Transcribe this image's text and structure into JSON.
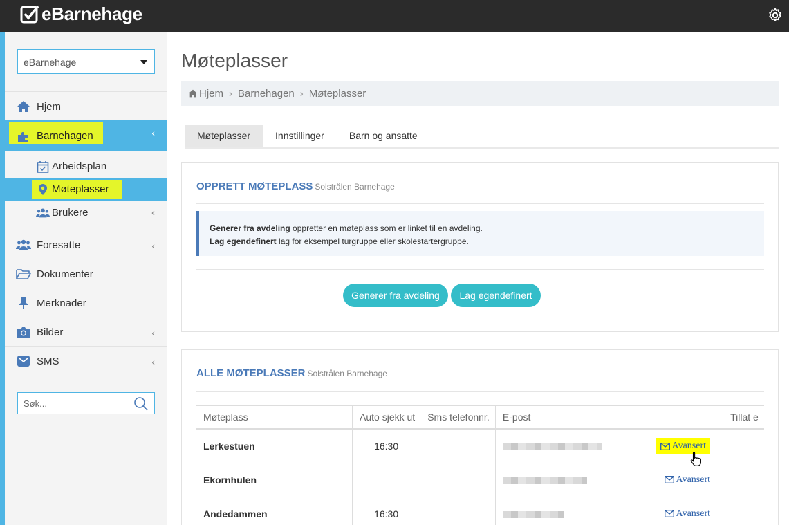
{
  "app": {
    "brand": "eBarnehage"
  },
  "sidebar": {
    "kindergarten_select": "eBarnehage",
    "items": [
      {
        "label": "Hjem",
        "icon": "home-icon"
      },
      {
        "label": "Barnehagen",
        "icon": "puzzle-icon"
      },
      {
        "label": "Foresatte",
        "icon": "users-icon"
      },
      {
        "label": "Dokumenter",
        "icon": "folder-icon"
      },
      {
        "label": "Merknader",
        "icon": "pin-icon"
      },
      {
        "label": "Bilder",
        "icon": "camera-icon"
      },
      {
        "label": "SMS",
        "icon": "envelope-icon"
      }
    ],
    "subitems": [
      {
        "label": "Arbeidsplan",
        "icon": "calendar-check-icon"
      },
      {
        "label": "Møteplasser",
        "icon": "map-marker-icon"
      },
      {
        "label": "Brukere",
        "icon": "users-icon"
      }
    ],
    "search_placeholder": "Søk..."
  },
  "main": {
    "title": "Møteplasser",
    "breadcrumb": [
      "Hjem",
      "Barnehagen",
      "Møteplasser"
    ],
    "tabs": [
      "Møteplasser",
      "Innstillinger",
      "Barn og ansatte"
    ]
  },
  "create_panel": {
    "title": "OPPRETT MØTEPLASS",
    "subtitle": "Solstrålen Barnehage",
    "info_line1_bold": "Generer fra avdeling",
    "info_line1_rest": " oppretter en møteplass som er linket til en avdeling.",
    "info_line2_bold": "Lag egendefinert",
    "info_line2_rest": " lag for eksempel turgruppe eller skolestartergruppe.",
    "btn_generate": "Generer fra avdeling",
    "btn_custom": "Lag egendefinert"
  },
  "list_panel": {
    "title": "ALLE MØTEPLASSER",
    "subtitle": "Solstrålen Barnehage",
    "columns": [
      "Møteplass",
      "Auto sjekk ut",
      "Sms telefonnr.",
      "E-post",
      "",
      "Tillat e"
    ],
    "rows": [
      {
        "name": "Lerkestuen",
        "auto_checkout": "16:30",
        "sms": "",
        "action": "Avansert"
      },
      {
        "name": "Ekornhulen",
        "auto_checkout": "",
        "sms": "",
        "action": "Avansert"
      },
      {
        "name": "Andedammen",
        "auto_checkout": "16:30",
        "sms": "",
        "action": "Avansert"
      }
    ]
  },
  "colors": {
    "accent": "#4fb5e4",
    "highlight": "#ffff00",
    "button": "#34bdc9",
    "title_blue": "#4a7ab8"
  }
}
